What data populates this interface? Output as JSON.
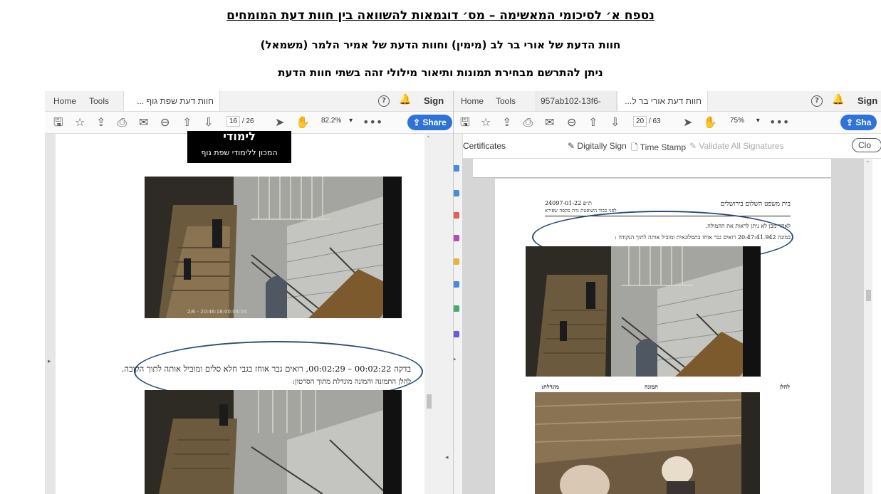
{
  "heading": {
    "line1": "נספח א׳ לסיכומי המאשימה – מס׳ דוגמאות להשוואה בין חוות דעת המומחים",
    "line2": "חוות הדעת של אורי בר לב (מימין) וחוות הדעת של אמיר הלמר (משמאל)",
    "line3": "ניתן להתרשם מבחירת תמונות ותיאור מילולי זהה בשתי חוות הדעת"
  },
  "left_window": {
    "menu_home": "Home",
    "menu_tools": "Tools",
    "tab_title": "חוות דעת שפת גוף ...",
    "sign_in": "Sign In",
    "page_current": "16",
    "page_total": "/ 26",
    "zoom": "82.2%",
    "share": "Share",
    "logo_text": "המכון ללימודי שפת גוף",
    "logo_small": "לימודי",
    "timestamp": "2/6 - 20:46:16:00:04:04",
    "caption_line1": "בדקה 00:02:22 – 00:02:29, רואים גבר אוחז בגבי חלא סלים ומוביל אותה לתוך הקובה.",
    "caption_line2": "להלן התמונה והמונה מוגדלת מתוך הסרטון:"
  },
  "right_window": {
    "menu_home": "Home",
    "menu_tools": "Tools",
    "tab_file": "957ab102-13f6-41...",
    "tab_title": "חוות דעת אורי בר ל...",
    "sign_in": "Sign",
    "page_current": "20",
    "page_total": "/ 63",
    "zoom": "75%",
    "share": "Sha",
    "certificates": "Certificates",
    "digitally_sign": "Digitally Sign",
    "time_stamp": "Time Stamp",
    "validate": "Validate All Signatures",
    "close": "Clo",
    "court_name": "בית משפט השלום בירושלים",
    "case_number": "ת״פ 24097-01-22",
    "judge": "לפני כבוד השופטת נויה סקפה שפירא",
    "doc_line1": "לאחר מכן לא ניתן לראות את ההמולה.",
    "doc_line2": "במונה 20:47:41.942 רואים גבר אוחז בתמלונאית ומוביל אותה לתוך הנקודה :",
    "col_right": "להלן",
    "col_mid": "תמונה",
    "col_left": "מוגדלת:"
  },
  "colors": {
    "ellipse": "#2f4d7a",
    "share_button": "#2f73d8"
  }
}
